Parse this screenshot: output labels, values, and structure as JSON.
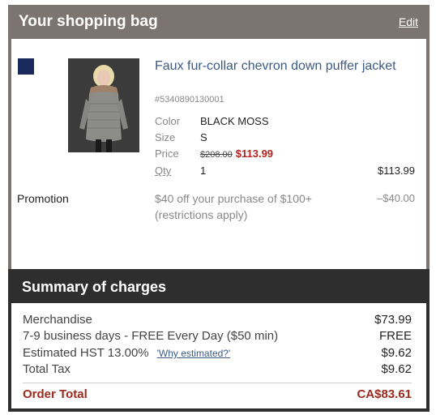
{
  "bag": {
    "title": "Your shopping bag",
    "edit_label": "Edit",
    "brand_logo_text": "GAP",
    "item": {
      "name": "Faux fur-collar chevron down puffer jacket",
      "sku": "#5340890130001",
      "color_label": "Color",
      "color_value": "BLACK MOSS",
      "size_label": "Size",
      "size_value": "S",
      "price_label": "Price",
      "price_original": "$208.00",
      "price_sale": "$113.99",
      "qty_label": "Qty",
      "qty_value": "1",
      "line_total": "$113.99"
    },
    "promotion": {
      "label": "Promotion",
      "description": "$40 off your purchase of $100+ (restrictions apply)",
      "amount": "–$40.00"
    }
  },
  "summary": {
    "title": "Summary of charges",
    "merchandise_label": "Merchandise",
    "merchandise_value": "$73.99",
    "shipping_label": "7-9 business days - FREE Every Day ($50 min)",
    "shipping_value": "FREE",
    "hst_label": "Estimated HST 13.00%",
    "why_link": "'Why estimated?'",
    "hst_value": "$9.62",
    "tax_label": "Total Tax",
    "tax_value": "$9.62",
    "order_total_label": "Order Total",
    "order_total_value": "CA$83.61"
  },
  "colors": {
    "header_gray": "#7c7470",
    "summary_dark": "#2e2e2e",
    "link_blue": "#3d5a85",
    "sale_red": "#b22222",
    "total_red": "#9b2a1f",
    "brand_navy": "#1a2a5c"
  }
}
